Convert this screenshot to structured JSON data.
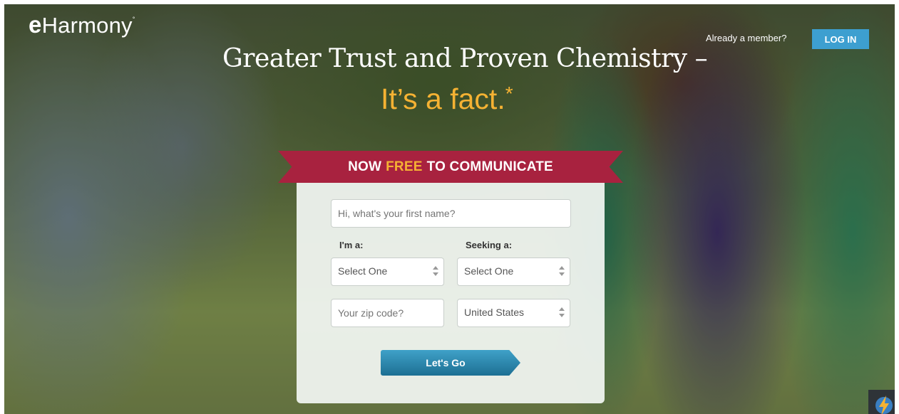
{
  "header": {
    "logo_e": "e",
    "logo_rest": "Harmony",
    "logo_mark": "°",
    "member_text": "Already a member?",
    "login_label": "LOG IN"
  },
  "hero": {
    "headline": "Greater Trust and Proven Chemistry –",
    "tagline": "It’s a fact.",
    "tagline_mark": "*"
  },
  "banner": {
    "prefix": "NOW",
    "highlight": "FREE",
    "suffix": "TO COMMUNICATE"
  },
  "form": {
    "first_name_placeholder": "Hi, what's your first name?",
    "im_a_label": "I'm a:",
    "seeking_label": "Seeking a:",
    "im_a_value": "Select One",
    "seeking_value": "Select One",
    "zip_placeholder": "Your zip code?",
    "country_value": "United States",
    "submit_label": "Let's Go"
  },
  "icons": {
    "corner_icon": "lightning-bolt-icon"
  },
  "colors": {
    "accent_gold": "#f5b233",
    "banner_red": "#a8223f",
    "login_blue": "#3d9fd0",
    "button_blue": "#1d6f93"
  }
}
